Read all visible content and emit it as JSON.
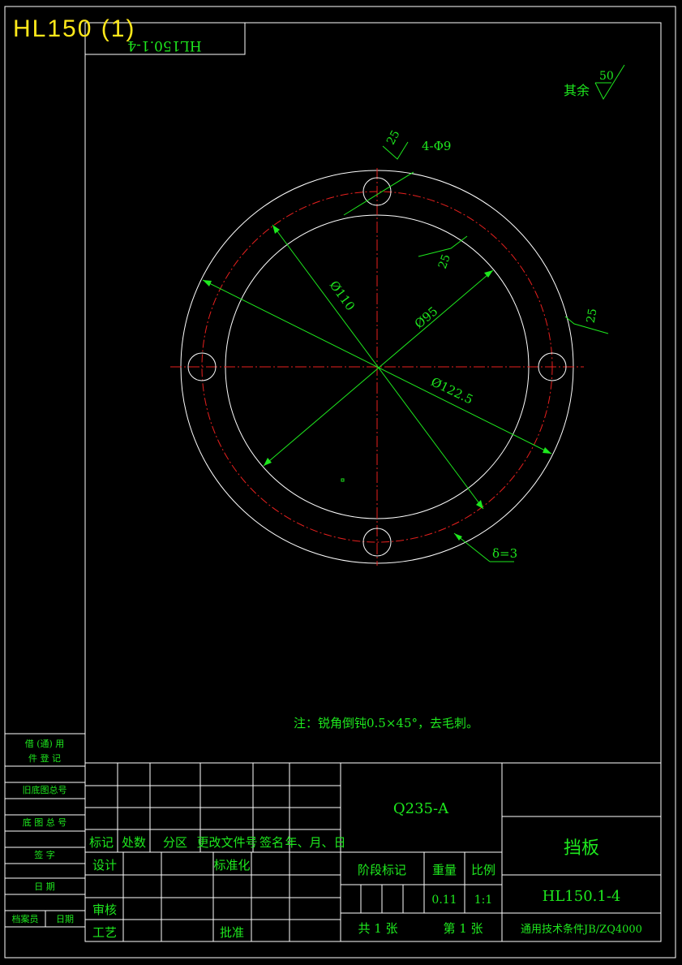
{
  "overlay_title": "HL150 (1)",
  "corner_label": "HL150.1-4",
  "roughness": {
    "label": "其余",
    "value": "50"
  },
  "dims": {
    "holes": "4-Φ9",
    "rough_hole": "25",
    "rough_inner": "25",
    "rough_outer": "25",
    "d_pitch": "Ø110",
    "d_inner": "Ø95",
    "d_outer": "Ø122.5",
    "thickness": "δ=3"
  },
  "note": "注：锐角倒钝0.5×45°，去毛刺。",
  "left_strip": {
    "b1_line1": "借 (通) 用",
    "b1_line2": "件 登 记",
    "old_base": "旧底图总号",
    "base_no": "底 图 总 号",
    "sign": "签 字",
    "date": "日 期",
    "archivist": "档案员",
    "archive_date": "日期"
  },
  "title_block": {
    "revision_headers": [
      "标记",
      "处数",
      "分区",
      "更改文件号",
      "签名",
      "年、月、日"
    ],
    "design": "设计",
    "standardize": "标准化",
    "review": "审核",
    "process": "工艺",
    "approve": "批准",
    "material": "Q235-A",
    "stage_mark": "阶段标记",
    "weight_label": "重量",
    "scale_label": "比例",
    "weight": "0.11",
    "scale": "1:1",
    "total_sheets": "共 1 张",
    "sheet_no": "第 1 张",
    "part_name": "挡板",
    "drawing_no": "HL150.1-4",
    "spec": "通用技术条件JB/ZQ4000"
  },
  "colors": {
    "line": "#ffffff",
    "dimension": "#1ee81e",
    "centerline": "#e8201e",
    "overlay": "#ffe81a"
  }
}
